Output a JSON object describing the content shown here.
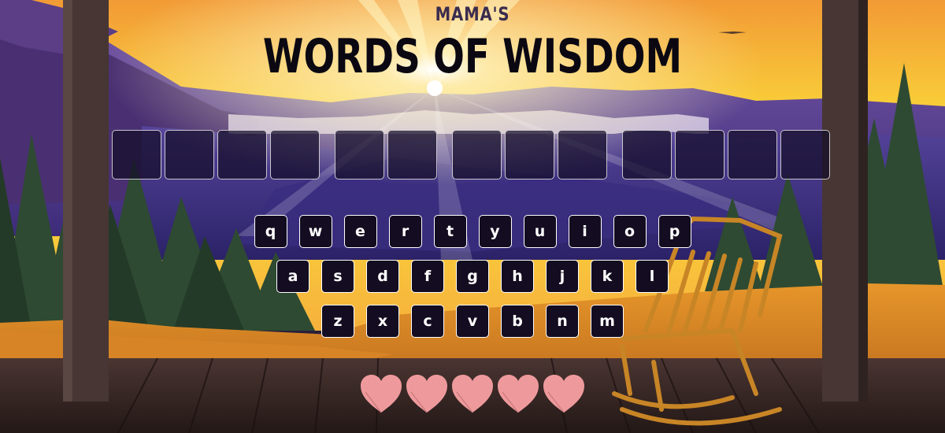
{
  "header": {
    "subtitle": "MAMA'S",
    "title": "WORDS OF WISDOM"
  },
  "puzzle": {
    "words": [
      4,
      2,
      3,
      4
    ]
  },
  "keyboard": {
    "rows": [
      [
        "q",
        "w",
        "e",
        "r",
        "t",
        "y",
        "u",
        "i",
        "o",
        "p"
      ],
      [
        "a",
        "s",
        "d",
        "f",
        "g",
        "h",
        "j",
        "k",
        "l"
      ],
      [
        "z",
        "x",
        "c",
        "v",
        "b",
        "n",
        "m"
      ]
    ]
  },
  "lives": {
    "remaining": 5,
    "icon": "heart-icon",
    "color": "#ee9a9c"
  },
  "colors": {
    "slot_bg": "#1a1030",
    "key_bg": "#140c20",
    "title": "#0b0812",
    "subtitle": "#3a2c4e"
  }
}
